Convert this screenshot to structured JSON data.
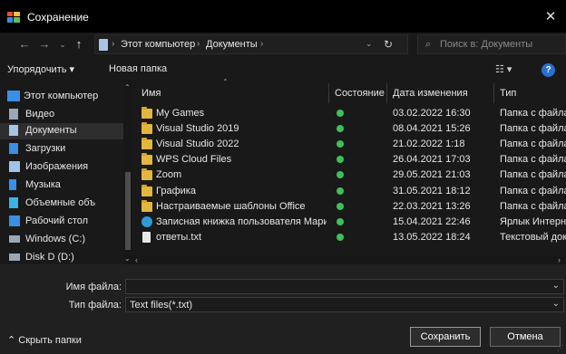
{
  "window": {
    "title": "Сохранение",
    "close": "✕"
  },
  "address": {
    "segments": [
      "Этот компьютер",
      "Документы"
    ],
    "search_placeholder": "Поиск в: Документы"
  },
  "toolbar": {
    "organize": "Упорядочить ▾",
    "new_folder": "Новая папка",
    "help": "?"
  },
  "nav": {
    "items": [
      {
        "label": "Этот компьютер",
        "icon": "computer-icon",
        "color": "#3a8ee6"
      },
      {
        "label": "Видео",
        "icon": "video-icon",
        "color": "#9aa7b5"
      },
      {
        "label": "Документы",
        "icon": "documents-icon",
        "color": "#a8c4e6"
      },
      {
        "label": "Загрузки",
        "icon": "downloads-icon",
        "color": "#3a8ee6"
      },
      {
        "label": "Изображения",
        "icon": "pictures-icon",
        "color": "#9fc4e8"
      },
      {
        "label": "Музыка",
        "icon": "music-icon",
        "color": "#3a8ee6"
      },
      {
        "label": "Объемные объ",
        "icon": "3d-objects-icon",
        "color": "#3ab4e6"
      },
      {
        "label": "Рабочий стол",
        "icon": "desktop-icon",
        "color": "#3a8ee6"
      },
      {
        "label": "Windows (C:)",
        "icon": "drive-icon",
        "color": "#9aa7b5"
      },
      {
        "label": "Disk D (D:)",
        "icon": "drive-icon",
        "color": "#9aa7b5"
      }
    ],
    "selected_index": 2
  },
  "columns": [
    "Имя",
    "Состояние",
    "Дата изменения",
    "Тип"
  ],
  "files": [
    {
      "name": "My Games",
      "date": "03.02.2022 16:30",
      "type": "Папка с файлами",
      "icon": "folder-icon"
    },
    {
      "name": "Visual Studio 2019",
      "date": "08.04.2021 15:26",
      "type": "Папка с файлами",
      "icon": "folder-icon"
    },
    {
      "name": "Visual Studio 2022",
      "date": "21.02.2022 1:18",
      "type": "Папка с файлами",
      "icon": "folder-icon"
    },
    {
      "name": "WPS Cloud Files",
      "date": "26.04.2021 17:03",
      "type": "Папка с файлами",
      "icon": "folder-icon"
    },
    {
      "name": "Zoom",
      "date": "29.05.2021 21:03",
      "type": "Папка с файлами",
      "icon": "folder-icon"
    },
    {
      "name": "Графика",
      "date": "31.05.2021 18:12",
      "type": "Папка с файлами",
      "icon": "folder-icon"
    },
    {
      "name": "Настраиваемые шаблоны Office",
      "date": "22.03.2021 13:26",
      "type": "Папка с файлами",
      "icon": "folder-icon"
    },
    {
      "name": "Записная книжка пользователя Мария",
      "date": "15.04.2021 22:46",
      "type": "Ярлык Интернета",
      "icon": "internet-shortcut-icon"
    },
    {
      "name": "ответы.txt",
      "date": "13.05.2022 18:24",
      "type": "Текстовый документ",
      "icon": "text-file-icon"
    }
  ],
  "status_color": "#3fbf5a",
  "form": {
    "filename_label": "Имя файла:",
    "filename_value": "",
    "filetype_label": "Тип файла:",
    "filetype_value": "Text files(*.txt)"
  },
  "buttons": {
    "hide_folders": "Скрыть папки",
    "save": "Сохранить",
    "cancel": "Отмена"
  }
}
